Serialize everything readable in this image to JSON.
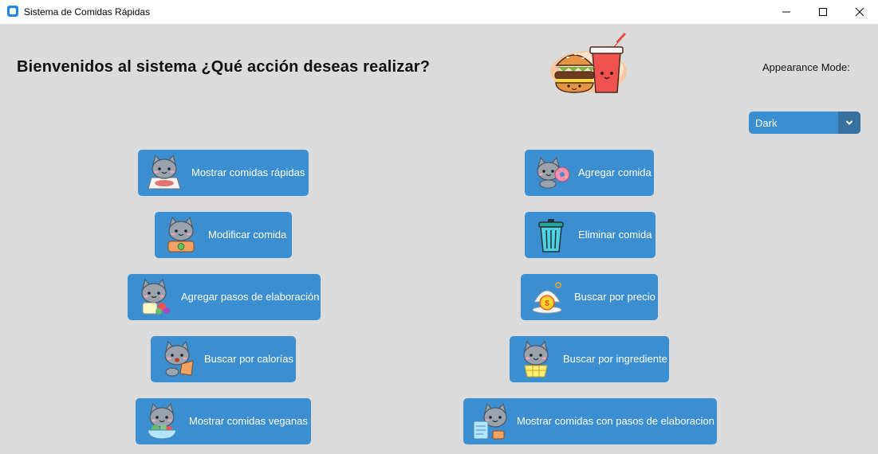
{
  "window": {
    "title": "Sistema de Comidas Rápidas",
    "controls": [
      "minimize-icon",
      "maximize-icon",
      "close-icon"
    ]
  },
  "header": {
    "headline": "Bienvenidos al sistema ¿Qué acción deseas realizar?",
    "logo_icon": "burger-and-soda-logo"
  },
  "appearance": {
    "label": "Appearance Mode:",
    "selected": "Dark"
  },
  "buttons": {
    "mostrar_comidas": {
      "label": "Mostrar comidas rápidas",
      "icon": "cat-pizza-icon"
    },
    "modificar_comida": {
      "label": "Modificar comida",
      "icon": "cat-camera-icon"
    },
    "agregar_pasos": {
      "label": "Agregar pasos de elaboración",
      "icon": "cat-flowers-icon"
    },
    "buscar_calorias": {
      "label": "Buscar por calorías",
      "icon": "cat-snack-icon"
    },
    "mostrar_veganas": {
      "label": "Mostrar comidas veganas",
      "icon": "cat-salad-icon"
    },
    "agregar_comida": {
      "label": "Agregar comida",
      "icon": "cat-donut-icon"
    },
    "eliminar_comida": {
      "label": "Eliminar comida",
      "icon": "trash-can-icon"
    },
    "buscar_precio": {
      "label": "Buscar por precio",
      "icon": "coin-icon"
    },
    "buscar_ingrediente": {
      "label": "Buscar por ingrediente",
      "icon": "cat-basket-icon"
    },
    "mostrar_pasos": {
      "label": "Mostrar comidas con pasos de elaboracion",
      "icon": "cat-recipe-icon"
    }
  }
}
